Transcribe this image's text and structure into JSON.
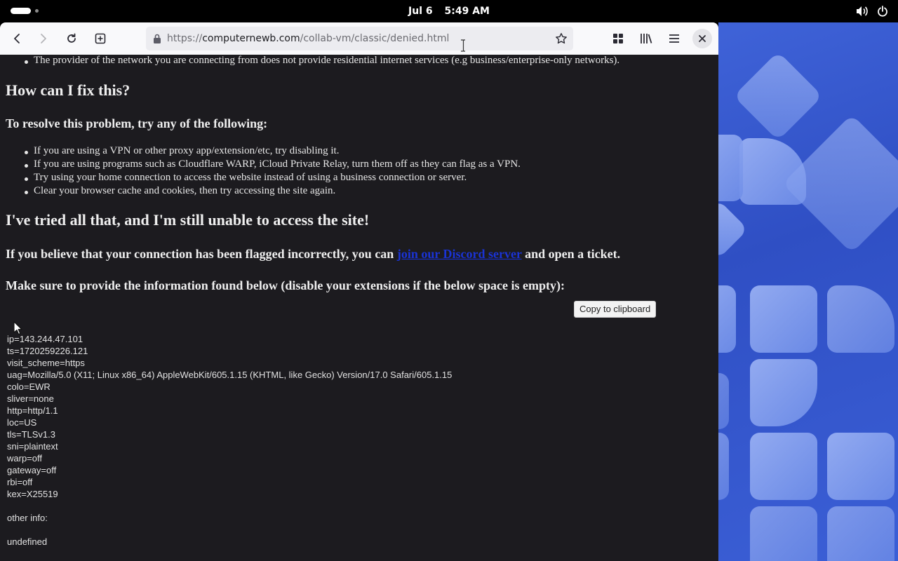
{
  "topbar": {
    "date": "Jul 6",
    "time": "5:49 AM",
    "icons": [
      "activities-indicator",
      "volume-icon",
      "power-icon"
    ]
  },
  "browser": {
    "url_prefix": "https://",
    "url_host": "computernewb.com",
    "url_path": "/collab-vm/classic/denied.html",
    "buttons": [
      "back",
      "forward",
      "reload",
      "new-tab",
      "bookmark-star",
      "extensions",
      "library",
      "menu",
      "close"
    ]
  },
  "page": {
    "top_bullet": "The provider of the network you are connecting from does not provide residential internet services (e.g business/enterprise-only networks).",
    "fix_heading": "How can I fix this?",
    "resolve_heading": "To resolve this problem, try any of the following:",
    "fixes": [
      "If you are using a VPN or other proxy app/extension/etc, try disabling it.",
      "If you are using programs such as Cloudflare WARP, iCloud Private Relay, turn them off as they can flag as a VPN.",
      "Try using your home connection to access the website instead of using a business connection or server.",
      "Clear your browser cache and cookies, then try accessing the site again."
    ],
    "tried_heading": "I've tried all that, and I'm still unable to access the site!",
    "flagged_prefix": "If you believe that your connection has been flagged incorrectly, you can ",
    "flagged_link": "join our Discord server",
    "flagged_suffix": " and open a ticket.",
    "provide_text": "Make sure to provide the information found below (disable your extensions if the below space is empty):",
    "copy_button": "Copy to clipboard",
    "info_lines": [
      "ip=143.244.47.101",
      "ts=1720259226.121",
      "visit_scheme=https",
      "uag=Mozilla/5.0 (X11; Linux x86_64) AppleWebKit/605.1.15 (KHTML, like Gecko) Version/17.0 Safari/605.1.15",
      "colo=EWR",
      "sliver=none",
      "http=http/1.1",
      "loc=US",
      "tls=TLSv1.3",
      "sni=plaintext",
      "warp=off",
      "gateway=off",
      "rbi=off",
      "kex=X25519",
      "",
      "other info:",
      "",
      "undefined"
    ]
  }
}
